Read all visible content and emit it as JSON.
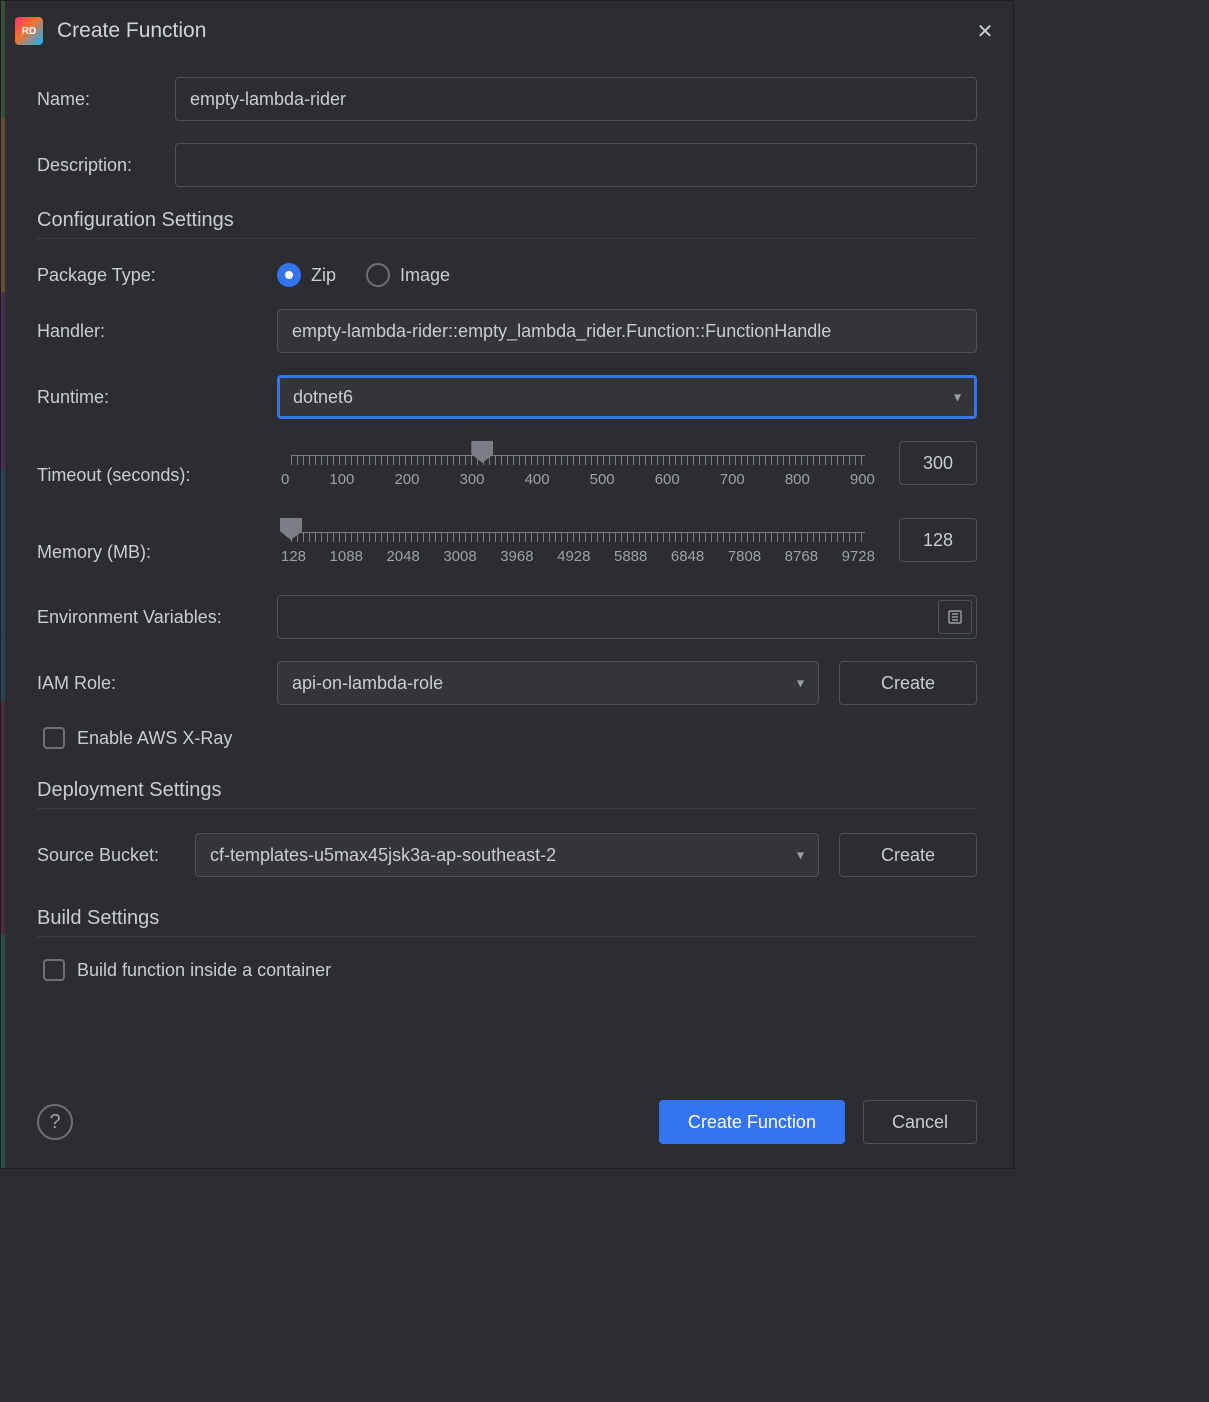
{
  "dialog": {
    "title": "Create Function"
  },
  "fields": {
    "name_label": "Name:",
    "name_value": "empty-lambda-rider",
    "description_label": "Description:",
    "description_value": ""
  },
  "config": {
    "header": "Configuration Settings",
    "package_type_label": "Package Type:",
    "package_zip": "Zip",
    "package_image": "Image",
    "package_selected": "zip",
    "handler_label": "Handler:",
    "handler_value": "empty-lambda-rider::empty_lambda_rider.Function::FunctionHandle",
    "runtime_label": "Runtime:",
    "runtime_value": "dotnet6",
    "timeout_label": "Timeout (seconds):",
    "timeout_value": "300",
    "timeout_ticks": [
      "0",
      "100",
      "200",
      "300",
      "400",
      "500",
      "600",
      "700",
      "800",
      "900"
    ],
    "memory_label": "Memory (MB):",
    "memory_value": "128",
    "memory_ticks": [
      "128",
      "1088",
      "2048",
      "3008",
      "3968",
      "4928",
      "5888",
      "6848",
      "7808",
      "8768",
      "9728"
    ],
    "env_label": "Environment Variables:",
    "iam_label": "IAM Role:",
    "iam_value": "api-on-lambda-role",
    "create_btn": "Create",
    "xray_label": "Enable AWS X-Ray"
  },
  "deploy": {
    "header": "Deployment Settings",
    "bucket_label": "Source Bucket:",
    "bucket_value": "cf-templates-u5max45jsk3a-ap-southeast-2",
    "create_btn": "Create"
  },
  "build": {
    "header": "Build Settings",
    "container_label": "Build function inside a container"
  },
  "footer": {
    "create": "Create Function",
    "cancel": "Cancel"
  }
}
